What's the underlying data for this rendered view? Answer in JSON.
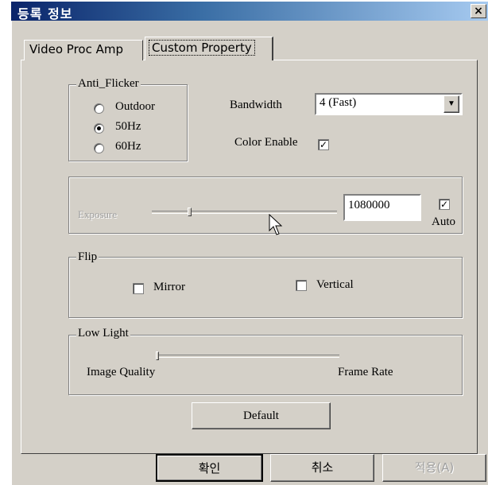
{
  "window": {
    "title": "등록 정보",
    "close_glyph": "×"
  },
  "tabs": [
    {
      "label": "Video Proc Amp"
    },
    {
      "label": "Custom Property"
    }
  ],
  "anti_flicker": {
    "legend": "Anti_Flicker",
    "options": [
      "Outdoor",
      "50Hz",
      "60Hz"
    ],
    "selected": "50Hz"
  },
  "bandwidth": {
    "label": "Bandwidth",
    "value": "4 (Fast)"
  },
  "color_enable": {
    "label": "Color Enable",
    "checked": true
  },
  "exposure": {
    "label": "Exposure",
    "value": "1080000",
    "auto_label": "Auto",
    "auto_checked": true
  },
  "flip": {
    "legend": "Flip",
    "mirror_label": "Mirror",
    "vertical_label": "Vertical"
  },
  "low_light": {
    "legend": "Low Light",
    "left_label": "Image Quality",
    "right_label": "Frame Rate"
  },
  "buttons": {
    "default": "Default",
    "ok": "확인",
    "cancel": "취소",
    "apply": "적용(A)"
  },
  "check_glyph": "✓"
}
